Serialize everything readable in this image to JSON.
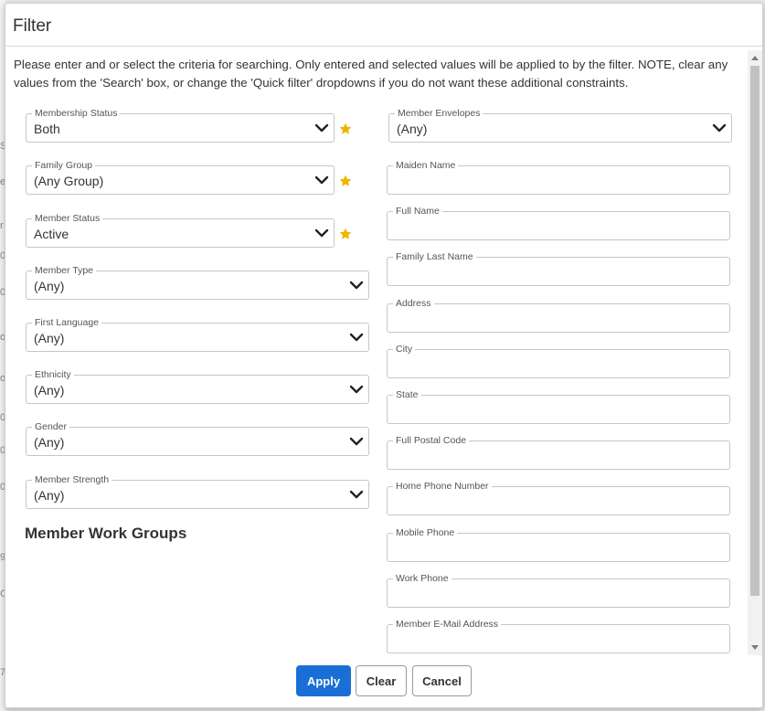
{
  "dialog": {
    "title": "Filter",
    "intro": "Please enter and or select the criteria for searching. Only entered and selected values will be applied to by the filter. NOTE, clear any values from the 'Search' box, or change the 'Quick filter' dropdowns if you do not want these additional constraints."
  },
  "left_selects": [
    {
      "label": "Membership Status",
      "value": "Both",
      "starred": true
    },
    {
      "label": "Family Group",
      "value": "(Any Group)",
      "starred": true
    },
    {
      "label": "Member Status",
      "value": "Active",
      "starred": true
    },
    {
      "label": "Member Type",
      "value": "(Any)",
      "starred": false
    },
    {
      "label": "First Language",
      "value": "(Any)",
      "starred": false
    },
    {
      "label": "Ethnicity",
      "value": "(Any)",
      "starred": false
    },
    {
      "label": "Gender",
      "value": "(Any)",
      "starred": false
    },
    {
      "label": "Member Strength",
      "value": "(Any)",
      "starred": false
    }
  ],
  "work_groups_title": "Member Work Groups",
  "right_select": {
    "label": "Member Envelopes",
    "value": "(Any)"
  },
  "right_inputs": [
    {
      "label": "Maiden Name",
      "value": ""
    },
    {
      "label": "Full Name",
      "value": ""
    },
    {
      "label": "Family Last Name",
      "value": ""
    },
    {
      "label": "Address",
      "value": ""
    },
    {
      "label": "City",
      "value": ""
    },
    {
      "label": "State",
      "value": ""
    },
    {
      "label": "Full Postal Code",
      "value": ""
    },
    {
      "label": "Home Phone Number",
      "value": ""
    },
    {
      "label": "Mobile Phone",
      "value": ""
    },
    {
      "label": "Work Phone",
      "value": ""
    },
    {
      "label": "Member E-Mail Address",
      "value": ""
    }
  ],
  "buttons": {
    "apply": "Apply",
    "clear": "Clear",
    "cancel": "Cancel"
  },
  "background_marks": [
    "S",
    "e",
    "r",
    "0",
    "0",
    "o",
    "o",
    "0",
    "0",
    "0",
    "9",
    "C",
    "7"
  ],
  "colors": {
    "primary": "#1a6fd6",
    "star": "#f0b400",
    "border": "#c6c6c6"
  },
  "icons": {
    "select_arrow": "chevron-down-icon",
    "favorite": "star-icon"
  }
}
